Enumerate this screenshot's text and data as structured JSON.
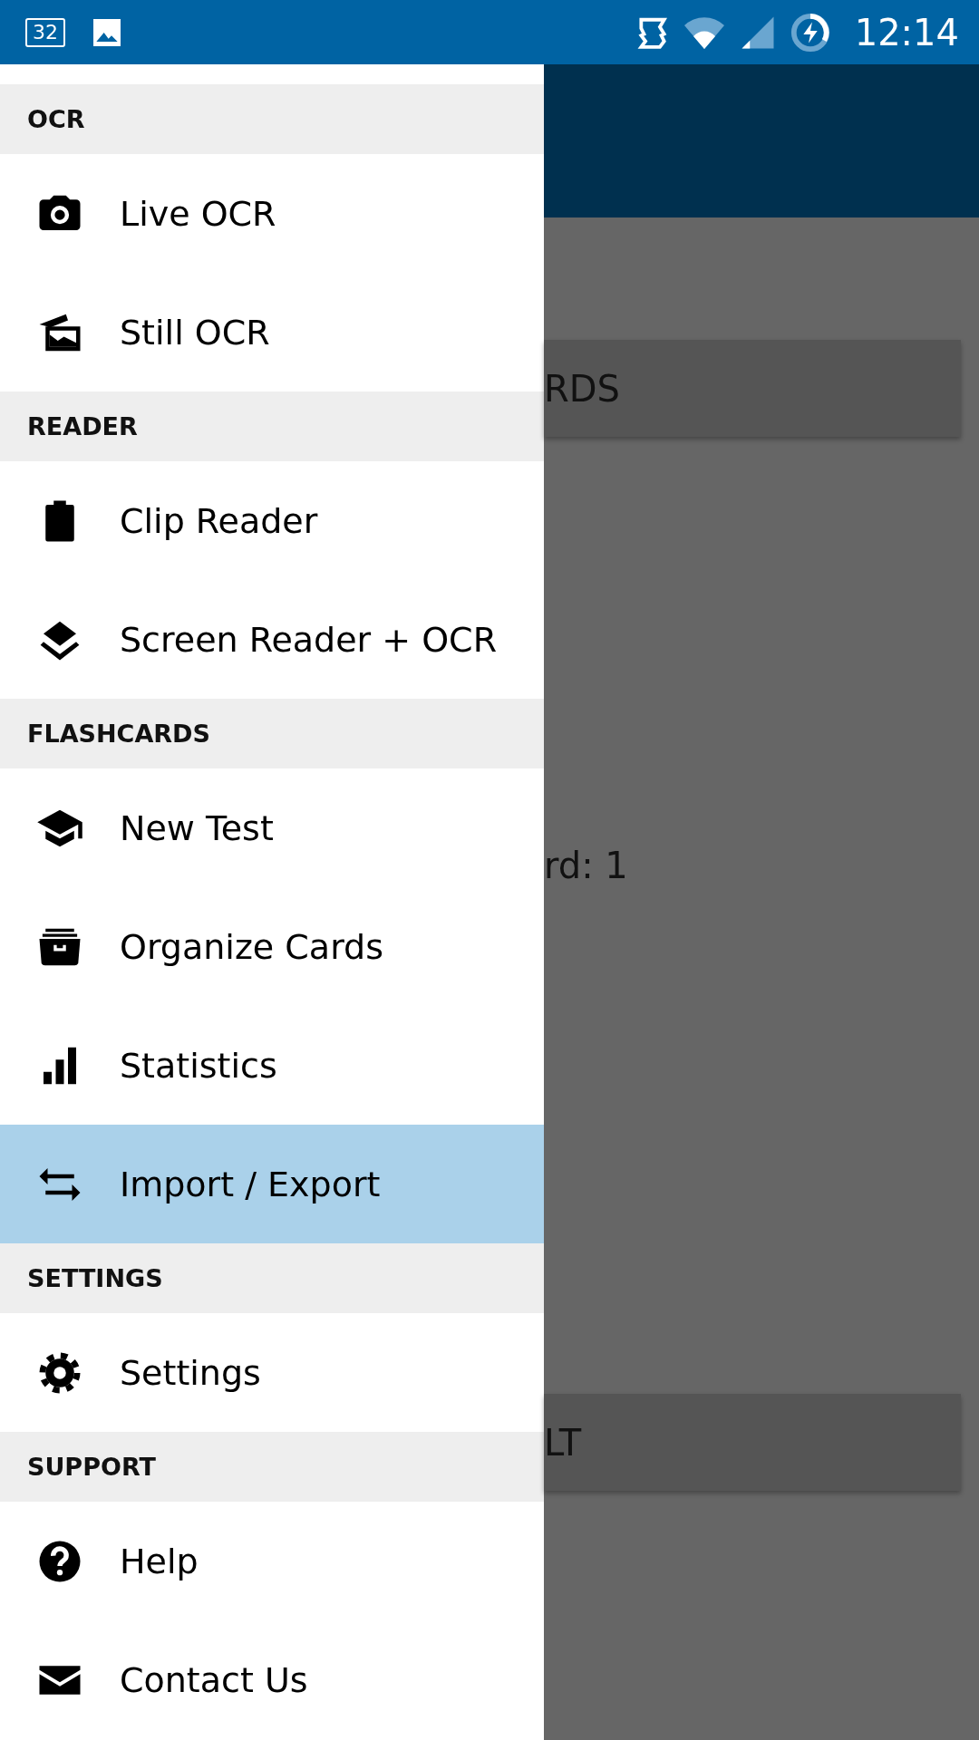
{
  "status_bar": {
    "notification_badge": "32",
    "time": "12:14"
  },
  "background": {
    "button_1": "RDS",
    "text": "rd: 1",
    "button_2": "LT"
  },
  "drawer": {
    "sections": [
      {
        "title": "OCR",
        "items": [
          {
            "label": "Live OCR",
            "selected": false
          },
          {
            "label": "Still OCR",
            "selected": false
          }
        ]
      },
      {
        "title": "READER",
        "items": [
          {
            "label": "Clip Reader",
            "selected": false
          },
          {
            "label": "Screen Reader + OCR",
            "selected": false
          }
        ]
      },
      {
        "title": "FLASHCARDS",
        "items": [
          {
            "label": "New Test",
            "selected": false
          },
          {
            "label": "Organize Cards",
            "selected": false
          },
          {
            "label": "Statistics",
            "selected": false
          },
          {
            "label": "Import / Export",
            "selected": true
          }
        ]
      },
      {
        "title": "SETTINGS",
        "items": [
          {
            "label": "Settings",
            "selected": false
          }
        ]
      },
      {
        "title": "SUPPORT",
        "items": [
          {
            "label": "Help",
            "selected": false
          },
          {
            "label": "Contact Us",
            "selected": false
          }
        ]
      }
    ]
  }
}
